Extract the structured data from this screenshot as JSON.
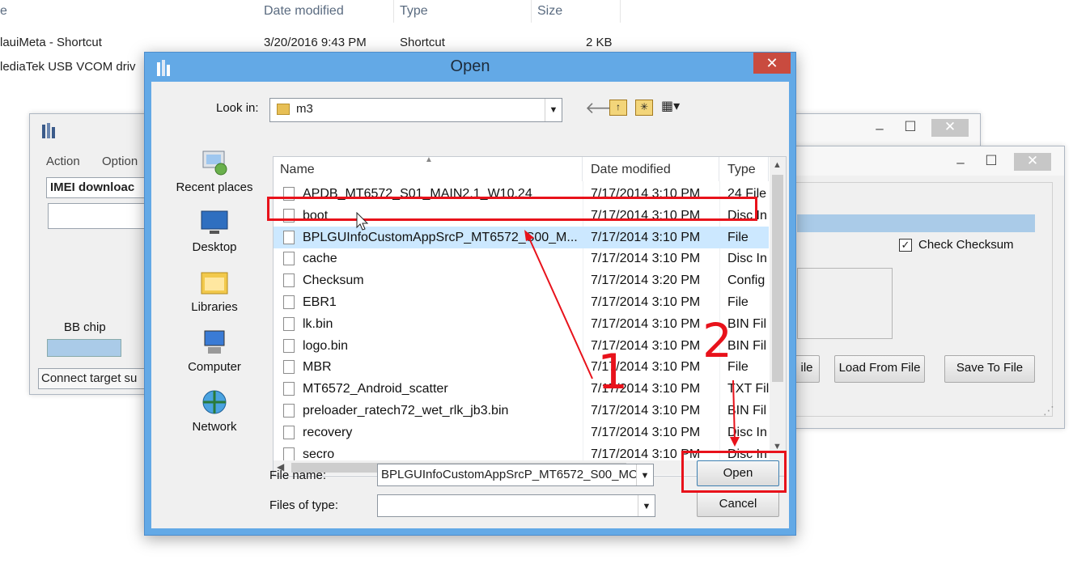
{
  "explorer": {
    "headers": [
      "Date modified",
      "Type",
      "Size"
    ],
    "rows": [
      {
        "name": "lauiMeta - Shortcut",
        "date": "3/20/2016 9:43 PM",
        "type": "Shortcut",
        "size": "2 KB"
      },
      {
        "name": "lediaTek USB VCOM driv",
        "date": "",
        "type": "",
        "size": ""
      }
    ]
  },
  "back_window": {
    "menu": [
      "Action",
      "Option"
    ],
    "imei_label": "IMEI downloac",
    "bb_chip_label": "BB chip",
    "status_text": "Connect target su"
  },
  "right_window": {
    "check_checksum": "Check Checksum",
    "btn_partial": "ile",
    "btn_load": "Load From File",
    "btn_save": "Save To File"
  },
  "dialog": {
    "title": "Open",
    "close_glyph": "✕",
    "look_in_label": "Look in:",
    "look_in_value": "m3",
    "places": [
      "Recent places",
      "Desktop",
      "Libraries",
      "Computer",
      "Network"
    ],
    "columns": [
      "Name",
      "Date modified",
      "Type"
    ],
    "files": [
      {
        "name": "APDB_MT6572_S01_MAIN2.1_W10.24",
        "date": "7/17/2014 3:10 PM",
        "type": "24 File"
      },
      {
        "name": "boot",
        "date": "7/17/2014 3:10 PM",
        "type": "Disc In"
      },
      {
        "name": "BPLGUInfoCustomAppSrcP_MT6572_S00_M...",
        "date": "7/17/2014 3:10 PM",
        "type": "File"
      },
      {
        "name": "cache",
        "date": "7/17/2014 3:10 PM",
        "type": "Disc In"
      },
      {
        "name": "Checksum",
        "date": "7/17/2014 3:20 PM",
        "type": "Config"
      },
      {
        "name": "EBR1",
        "date": "7/17/2014 3:10 PM",
        "type": "File"
      },
      {
        "name": "lk.bin",
        "date": "7/17/2014 3:10 PM",
        "type": "BIN Fil"
      },
      {
        "name": "logo.bin",
        "date": "7/17/2014 3:10 PM",
        "type": "BIN Fil"
      },
      {
        "name": "MBR",
        "date": "7/17/2014 3:10 PM",
        "type": "File"
      },
      {
        "name": "MT6572_Android_scatter",
        "date": "7/17/2014 3:10 PM",
        "type": "TXT Fil"
      },
      {
        "name": "preloader_ratech72_wet_rlk_jb3.bin",
        "date": "7/17/2014 3:10 PM",
        "type": "BIN Fil"
      },
      {
        "name": "recovery",
        "date": "7/17/2014 3:10 PM",
        "type": "Disc In"
      },
      {
        "name": "secro",
        "date": "7/17/2014 3:10 PM",
        "type": "Disc In"
      }
    ],
    "selected_index": 2,
    "file_name_label": "File name:",
    "file_name_value": "BPLGUInfoCustomAppSrcP_MT6572_S00_MO",
    "files_of_type_label": "Files of type:",
    "files_of_type_value": "",
    "open_button": "Open",
    "cancel_button": "Cancel"
  },
  "annotations": {
    "step1": "1",
    "step2": "2",
    "color": "#e8121b"
  },
  "colors": {
    "dialog_frame": "#63a9e6",
    "close_button": "#c94b3f",
    "selection": "#cce8ff"
  }
}
